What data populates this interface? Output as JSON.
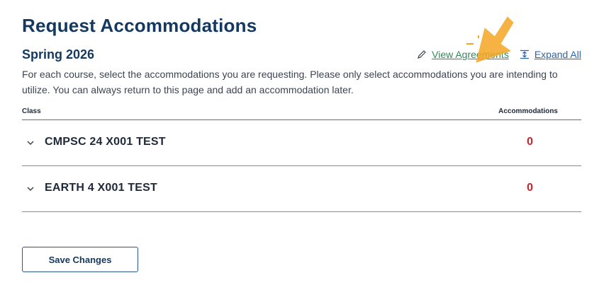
{
  "page": {
    "title": "Request Accommodations",
    "term": "Spring 2026",
    "description": "For each course, select the accommodations you are requesting. Please only select accommodations you are intending to utilize. You can always return to this page and add an accommodation later."
  },
  "links": {
    "view_agreements": "View Agreements",
    "expand_all": "Expand All"
  },
  "table": {
    "headers": {
      "class": "Class",
      "accommodations": "Accommodations"
    },
    "rows": [
      {
        "course": "CMPSC 24 X001 TEST",
        "count": "0"
      },
      {
        "course": "EARTH 4 X001 TEST",
        "count": "0"
      }
    ]
  },
  "actions": {
    "save_label": "Save Changes"
  },
  "colors": {
    "title": "#14385f",
    "count": "#d0202a",
    "agreements_link": "#2f8a5a",
    "expand_link": "#2a64b0",
    "cursor_highlight": "#f5a623"
  },
  "icons": [
    "pencil-icon",
    "expand-icon",
    "chevron-down-icon",
    "pointer-cursor-icon"
  ]
}
